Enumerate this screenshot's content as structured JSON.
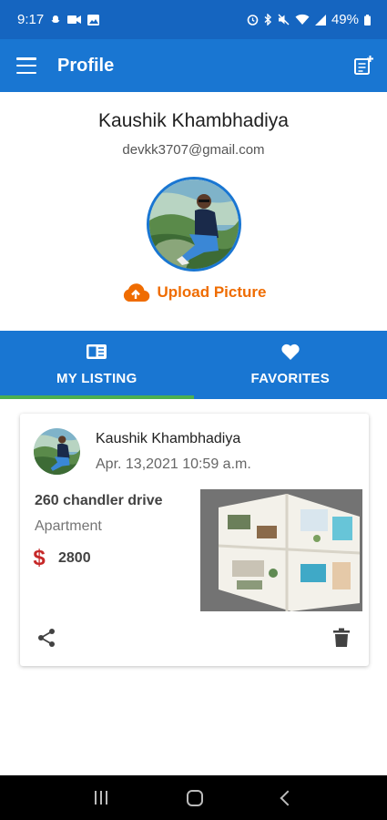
{
  "status_bar": {
    "time": "9:17",
    "battery": "49%",
    "left_icons": [
      "snapchat-icon",
      "video-icon",
      "image-icon"
    ],
    "right_icons": [
      "alarm-icon",
      "bluetooth-icon",
      "mute-icon",
      "wifi-icon",
      "signal-icon",
      "battery-icon"
    ]
  },
  "app_bar": {
    "title": "Profile",
    "menu_icon": "menu-icon",
    "action_icon": "note-add-icon"
  },
  "profile": {
    "name": "Kaushik Khambhadiya",
    "email": "devkk3707@gmail.com",
    "upload_label": "Upload Picture",
    "upload_icon": "cloud-upload-icon"
  },
  "tabs": [
    {
      "label": "MY LISTING",
      "icon": "listing-icon",
      "selected": true
    },
    {
      "label": "FAVORITES",
      "icon": "heart-icon",
      "selected": false
    }
  ],
  "listing": {
    "user_name": "Kaushik Khambhadiya",
    "date": "Apr. 13,2021 10:59 a.m.",
    "title": "260 chandler drive",
    "type": "Apartment",
    "currency_symbol": "$",
    "price": "2800",
    "share_icon": "share-icon",
    "delete_icon": "delete-icon"
  },
  "colors": {
    "primary": "#1976d2",
    "status_bar": "#1565c0",
    "accent_orange": "#ef6c00",
    "tab_indicator": "#4caf50",
    "price_red": "#c62828"
  }
}
